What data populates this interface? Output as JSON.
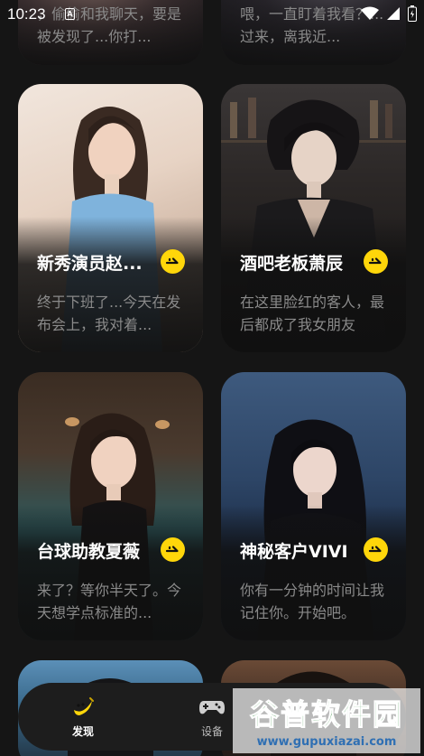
{
  "status_bar": {
    "time": "10:23",
    "app_indicator": "A"
  },
  "cards": [
    {
      "name": "",
      "desc": "，偷偷和我聊天，要是被发现了...你打..."
    },
    {
      "name": "",
      "desc": "喂，一直盯着我看？...过来，离我近..."
    },
    {
      "name": "新秀演员赵...",
      "desc": "终于下班了...今天在发布会上，我对着..."
    },
    {
      "name": "酒吧老板萧辰",
      "desc": "在这里脸红的客人，最后都成了我女朋友"
    },
    {
      "name": "台球助教夏薇",
      "desc": "来了？等你半天了。今天想学点标准的..."
    },
    {
      "name": "神秘客户VIVI",
      "desc": "你有一分钟的时间让我记住你。开始吧。"
    }
  ],
  "bottom_nav": {
    "items": [
      {
        "label": "发现",
        "icon": "banana-icon",
        "active": true
      },
      {
        "label": "设备",
        "icon": "gamepad-icon",
        "active": false
      }
    ]
  },
  "watermark": {
    "title": "谷普软件园",
    "url": "www.gupuxiazai.com"
  },
  "colors": {
    "accent": "#ffd60a",
    "background": "#151515",
    "card_desc": "#8a8a8a"
  }
}
